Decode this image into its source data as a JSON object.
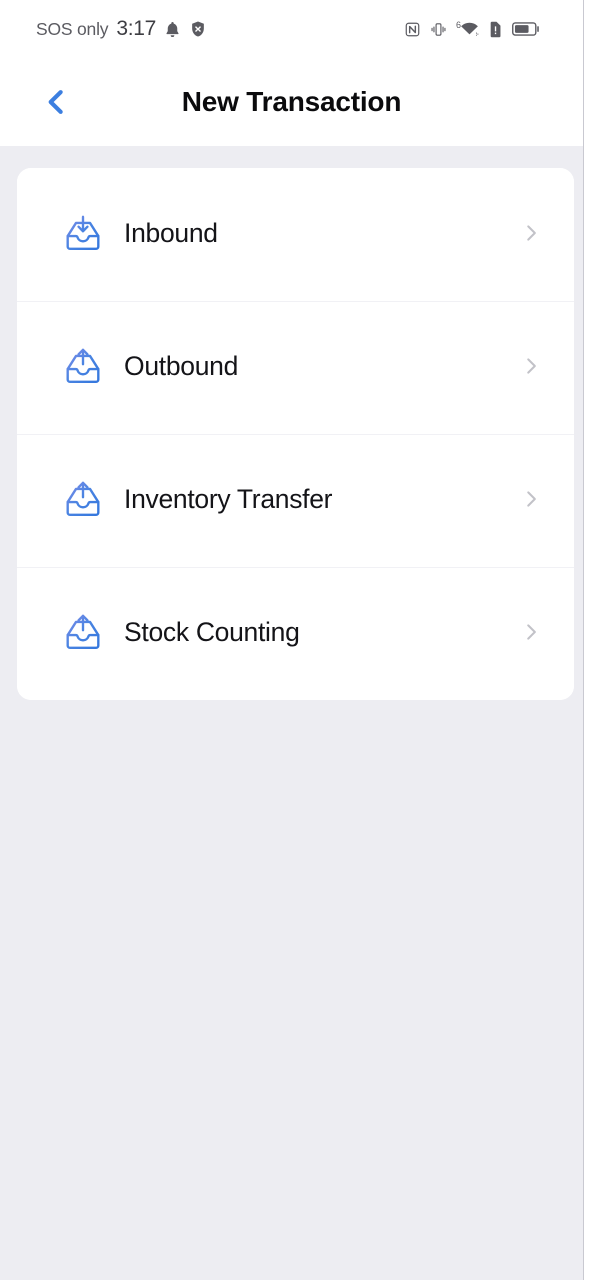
{
  "status_bar": {
    "carrier": "SOS only",
    "time": "3:17",
    "left_icons": [
      "bell-icon",
      "shield-block-icon"
    ],
    "right_icons": [
      "nfc-icon",
      "vibrate-icon",
      "wifi-6-icon",
      "sim-alert-icon",
      "battery-icon"
    ],
    "wifi_generation": "6",
    "text_color": "#5b5b61"
  },
  "app_bar": {
    "back_label": "chevron-left-icon",
    "title": "New Transaction",
    "accent_color": "#3c7fe0"
  },
  "menu": {
    "items": [
      {
        "label": "Inbound",
        "icon": "tray-arrow-down-icon",
        "chevron": "chevron-right-icon"
      },
      {
        "label": "Outbound",
        "icon": "tray-arrow-up-icon",
        "chevron": "chevron-right-icon"
      },
      {
        "label": "Inventory Transfer",
        "icon": "tray-arrow-up-icon",
        "chevron": "chevron-right-icon"
      },
      {
        "label": "Stock Counting",
        "icon": "tray-arrow-up-icon",
        "chevron": "chevron-right-icon"
      }
    ]
  },
  "colors": {
    "background": "#ededf2",
    "card": "#ffffff",
    "icon_blue": "#3c7fe0",
    "icon_blue_light": "#6f8fe8",
    "divider": "#f1f1f5",
    "chevron_gray": "#c2c2c8",
    "title": "#0b0b0d"
  }
}
